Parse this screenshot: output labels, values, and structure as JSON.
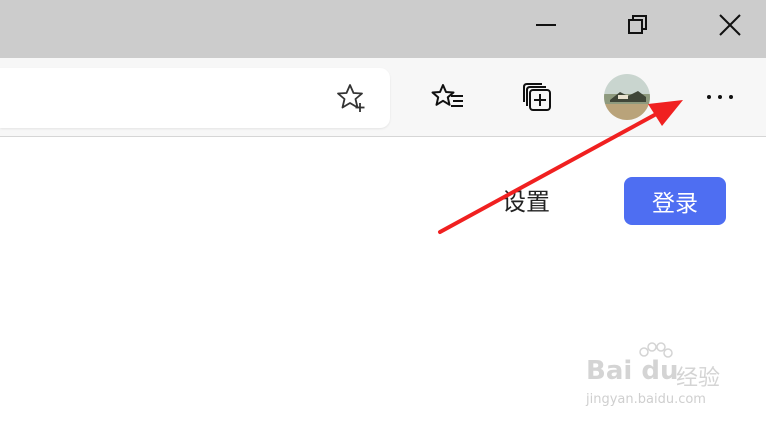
{
  "window_controls": {
    "minimize": "minimize-icon",
    "restore": "restore-icon",
    "close": "close-icon"
  },
  "toolbar": {
    "favorite_icon": "star-add-icon",
    "favorites_icon": "favorites-list-icon",
    "collections_icon": "collections-icon",
    "profile_icon": "profile-avatar",
    "more_label": "···"
  },
  "page": {
    "settings_label": "设置",
    "login_label": "登录",
    "login_color": "#4e6ef2"
  },
  "annotation": {
    "arrow_color": "#f02020"
  },
  "watermark": {
    "logo": "Bai du",
    "brand_cn": "经验",
    "url": "jingyan.baidu.com"
  }
}
